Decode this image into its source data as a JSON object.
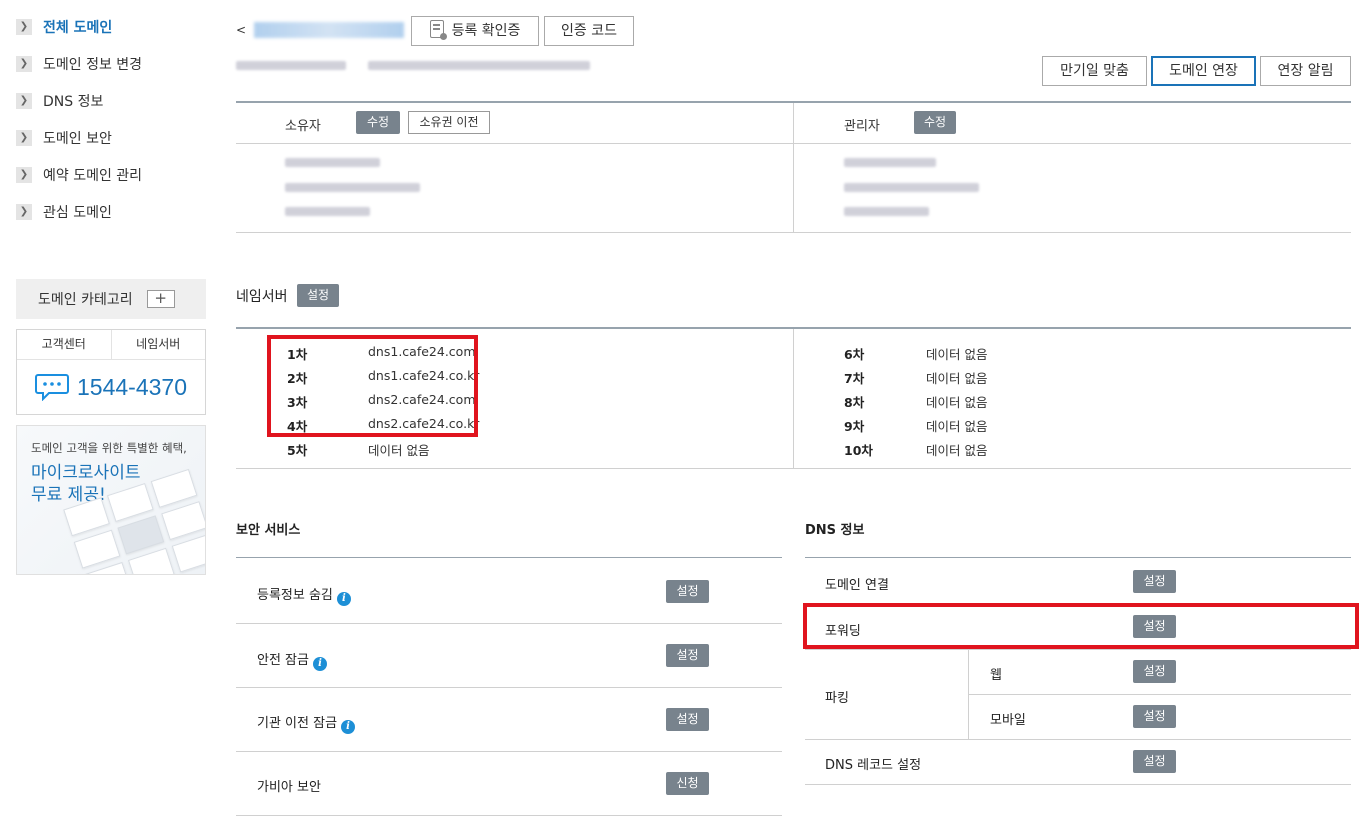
{
  "sidebar": {
    "items": [
      {
        "label": "전체 도메인"
      },
      {
        "label": "도메인 정보 변경"
      },
      {
        "label": "DNS 정보"
      },
      {
        "label": "도메인 보안"
      },
      {
        "label": "예약 도메인 관리"
      },
      {
        "label": "관심 도메인"
      }
    ],
    "category": {
      "label": "도메인 카테고리",
      "add_label": "+"
    },
    "support": {
      "tab_customer": "고객센터",
      "tab_nameserver": "네임서버",
      "phone": "1544-4370"
    },
    "promo": {
      "subtitle": "도메인 고객을 위한 특별한 혜택,",
      "title_line1": "마이크로사이트",
      "title_line2": "무료 제공!"
    }
  },
  "header": {
    "back_label": "<",
    "cert_button": "등록 확인증",
    "auth_code_button": "인증 코드",
    "expiry_button": "만기일 맞춤",
    "renew_button": "도메인 연장",
    "renew_alert_button": "연장 알림"
  },
  "contacts": {
    "owner_label": "소유자",
    "owner_edit": "수정",
    "owner_transfer": "소유권 이전",
    "admin_label": "관리자",
    "admin_edit": "수정"
  },
  "nameserver": {
    "title": "네임서버",
    "set_label": "설정",
    "left": [
      {
        "no": "1차",
        "value": "dns1.cafe24.com"
      },
      {
        "no": "2차",
        "value": "dns1.cafe24.co.kr"
      },
      {
        "no": "3차",
        "value": "dns2.cafe24.com"
      },
      {
        "no": "4차",
        "value": "dns2.cafe24.co.kr"
      },
      {
        "no": "5차",
        "value": "데이터 없음"
      }
    ],
    "right": [
      {
        "no": "6차",
        "value": "데이터 없음"
      },
      {
        "no": "7차",
        "value": "데이터 없음"
      },
      {
        "no": "8차",
        "value": "데이터 없음"
      },
      {
        "no": "9차",
        "value": "데이터 없음"
      },
      {
        "no": "10차",
        "value": "데이터 없음"
      }
    ]
  },
  "security": {
    "title": "보안 서비스",
    "rows": [
      {
        "label": "등록정보 숨김",
        "action": "설정"
      },
      {
        "label": "안전 잠금",
        "action": "설정"
      },
      {
        "label": "기관 이전 잠금",
        "action": "설정"
      },
      {
        "label": "가비아 보안",
        "action": "신청"
      }
    ]
  },
  "dns": {
    "title": "DNS 정보",
    "domain_link": {
      "label": "도메인 연결",
      "action": "설정"
    },
    "forwarding": {
      "label": "포워딩",
      "action": "설정"
    },
    "parking": {
      "label": "파킹",
      "web_label": "웹",
      "web_action": "설정",
      "mobile_label": "모바일",
      "mobile_action": "설정"
    },
    "dns_record": {
      "label": "DNS 레코드 설정",
      "action": "설정"
    }
  },
  "colors": {
    "accent": "#1a73b8",
    "highlight": "#e0141e",
    "tag": "#78838d"
  }
}
